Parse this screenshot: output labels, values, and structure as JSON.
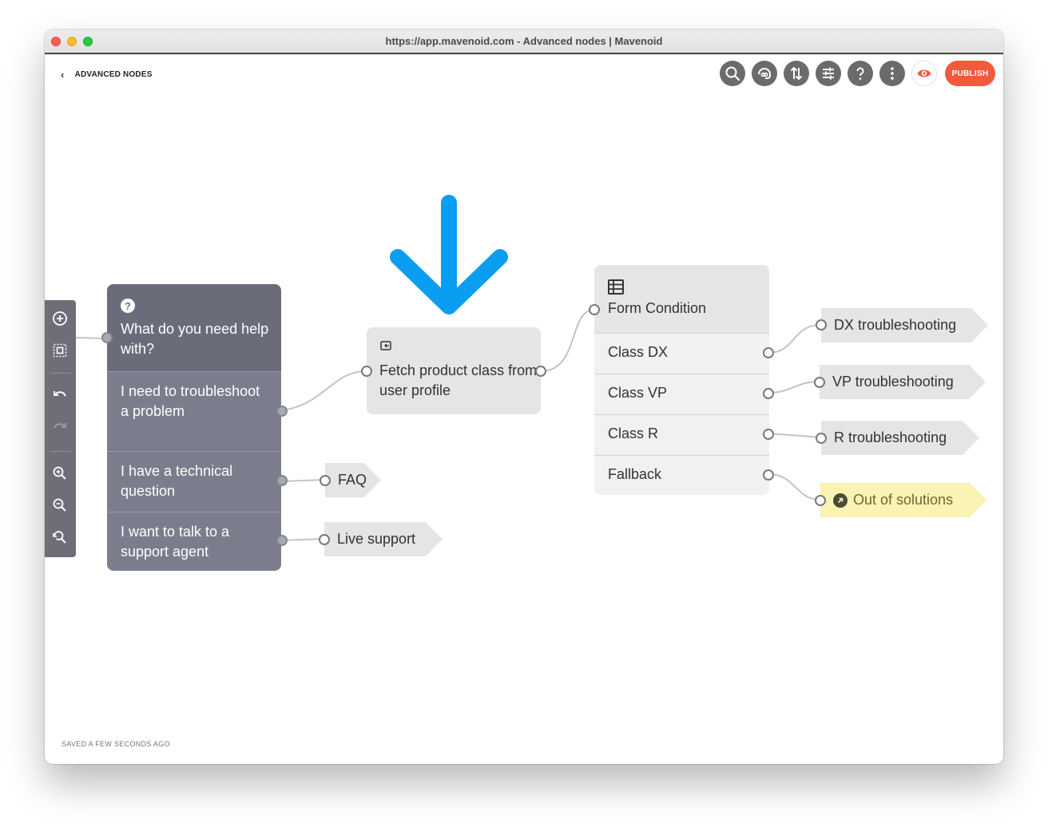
{
  "window": {
    "title": "https://app.mavenoid.com - Advanced nodes | Mavenoid"
  },
  "header": {
    "back_icon": "chevron-left-icon",
    "breadcrumb": "ADVANCED NODES",
    "toolbar_icons": [
      "search-icon",
      "chatbot-icon",
      "sort-icon",
      "sliders-icon",
      "help-icon",
      "more-vertical-icon",
      "preview-eye-icon"
    ],
    "publish_label": "PUBLISH",
    "accent_color": "#f25a3c"
  },
  "status": {
    "saved_text": "SAVED A FEW SECONDS AGO"
  },
  "side_toolbar": {
    "tools": [
      "add-icon",
      "select-icon",
      "undo-icon",
      "redo-icon",
      "zoom-in-icon",
      "zoom-out-icon",
      "zoom-reset-icon"
    ]
  },
  "canvas": {
    "question_node": {
      "icon": "question-icon",
      "title": "What do you need help with?",
      "options": [
        "I need to troubleshoot a problem",
        "I have a technical question",
        "I want to talk to a support agent"
      ]
    },
    "fetch_node": {
      "icon": "fetch-icon",
      "title": "Fetch product class from user profile"
    },
    "form_condition_node": {
      "icon": "table-icon",
      "title": "Form Condition",
      "conditions": [
        "Class DX",
        "Class VP",
        "Class R",
        "Fallback"
      ]
    },
    "targets": {
      "faq": "FAQ",
      "live_support": "Live support",
      "dx": "DX troubleshooting",
      "vp": "VP troubleshooting",
      "r": "R troubleshooting",
      "out_of_solutions": "Out of solutions"
    },
    "annotation_arrow_color": "#0b9df0"
  }
}
